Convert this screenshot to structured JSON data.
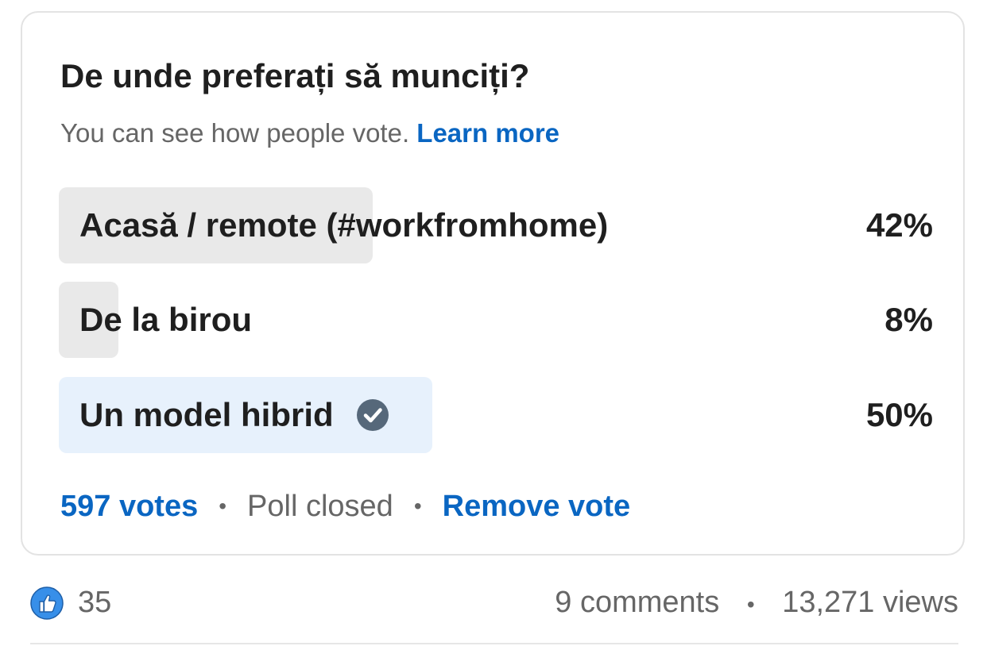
{
  "poll": {
    "question": "De unde preferați să munciți?",
    "subtitle": "You can see how people vote.",
    "learn_more": "Learn more",
    "options": [
      {
        "label": "Acasă / remote (#workfromhome)",
        "percent_text": "42%",
        "share": 0.42,
        "selected": false
      },
      {
        "label": "De la birou",
        "percent_text": "8%",
        "share": 0.08,
        "selected": false
      },
      {
        "label": "Un model hibrid",
        "percent_text": "50%",
        "share": 0.5,
        "selected": true
      }
    ],
    "votes": "597 votes",
    "status": "Poll closed",
    "remove_vote": "Remove vote"
  },
  "social": {
    "reaction_icon": "like-icon",
    "reactions": "35",
    "comments": "9 comments",
    "views": "13,271 views"
  },
  "colors": {
    "link": "#0a66c2",
    "bar_fill": "#e9e9e9",
    "bar_selected": "#e7f1fc",
    "check_icon": "#56687a",
    "like_icon": "#378fe9"
  },
  "separator": "•"
}
